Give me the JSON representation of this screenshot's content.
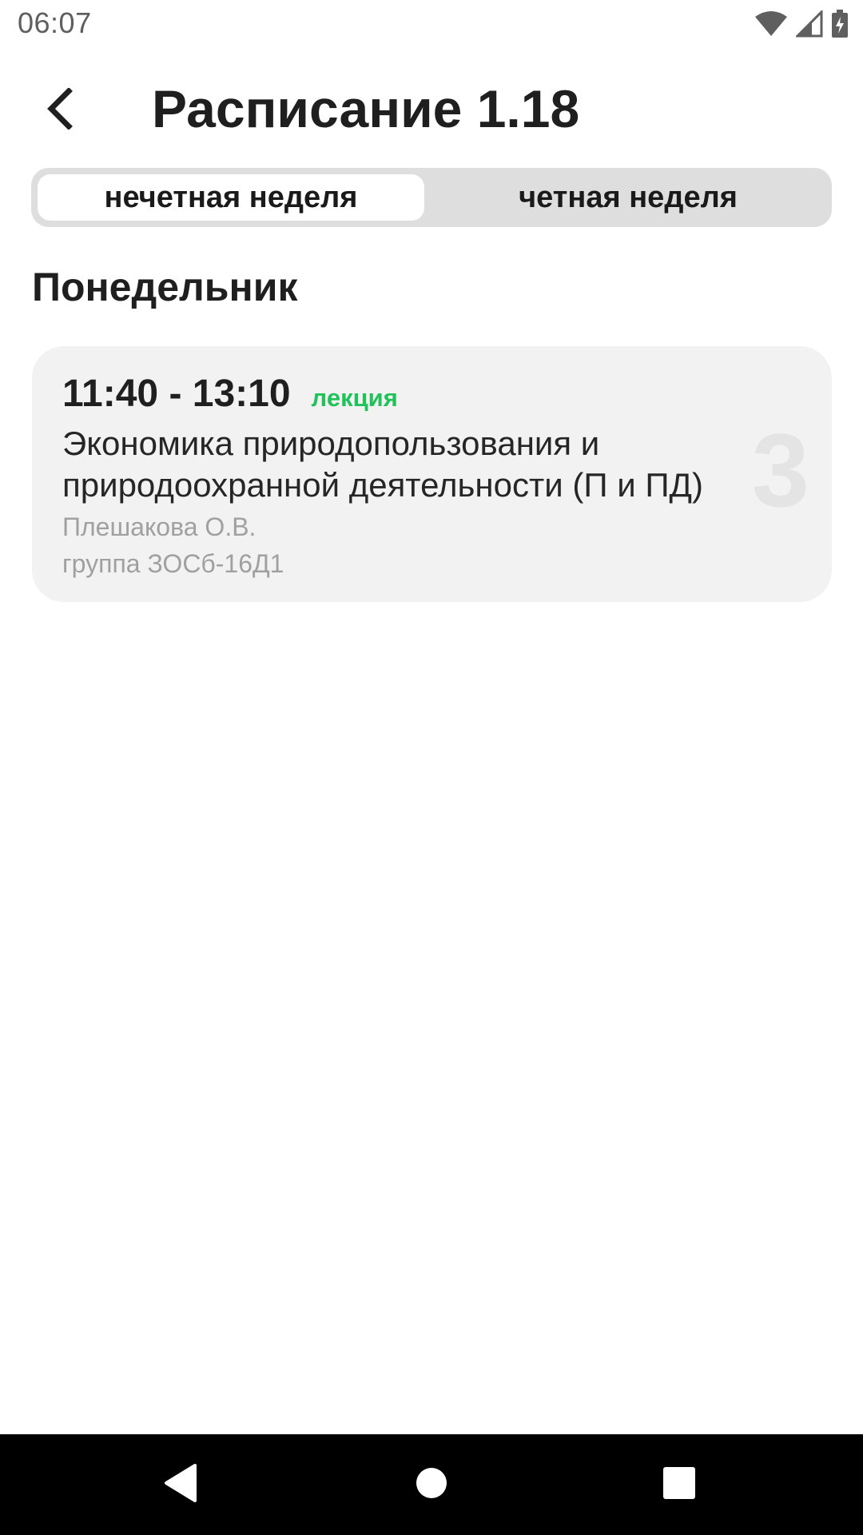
{
  "status_bar": {
    "time": "06:07",
    "icons": [
      "wifi-icon",
      "cellular-signal-icon",
      "battery-charging-icon"
    ]
  },
  "header": {
    "title": "Расписание 1.18",
    "back_icon": "chevron-left-icon"
  },
  "week_tabs": [
    {
      "label": "нечетная неделя",
      "selected": true
    },
    {
      "label": "четная неделя",
      "selected": false
    }
  ],
  "schedule": {
    "day": "Понедельник",
    "lessons": [
      {
        "number": "3",
        "time": "11:40 - 13:10",
        "type": "лекция",
        "title": "Экономика природопользования и природоохранной деятельности (П и ПД)",
        "teacher": "Плешакова О.В.",
        "group": "группа ЗОСб-16Д1"
      }
    ]
  },
  "nav_bar": {
    "icons": [
      "back-triangle-icon",
      "home-circle-icon",
      "recents-square-icon"
    ]
  },
  "colors": {
    "lesson_type": "#21c25a",
    "card_background": "#f2f2f2",
    "segmented_background": "#dedede",
    "nav_bar": "#000000"
  }
}
